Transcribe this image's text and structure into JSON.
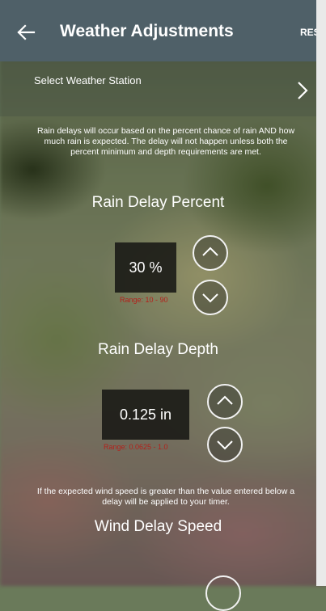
{
  "header": {
    "title": "Weather Adjustments",
    "reset_label": "RESET",
    "back_icon": "arrow-left-icon"
  },
  "station": {
    "label": "Select Weather Station",
    "chevron_icon": "chevron-right-icon"
  },
  "rain_info": "Rain delays will occur based on the percent chance of rain AND how much rain is expected. The delay will not happen unless both the percent minimum and depth requirements are met.",
  "rain_percent": {
    "heading": "Rain Delay Percent",
    "value": "30 %",
    "range": "Range: 10 - 90"
  },
  "rain_depth": {
    "heading": "Rain Delay Depth",
    "value": "0.125 in",
    "range": "Range: 0.0625 - 1.0"
  },
  "wind_info": "If the expected wind speed is greater than the value entered below a delay will be applied to your timer.",
  "wind_speed": {
    "heading": "Wind Delay Speed"
  },
  "colors": {
    "topbar": "#4f6068",
    "range_text": "#b3201b"
  }
}
